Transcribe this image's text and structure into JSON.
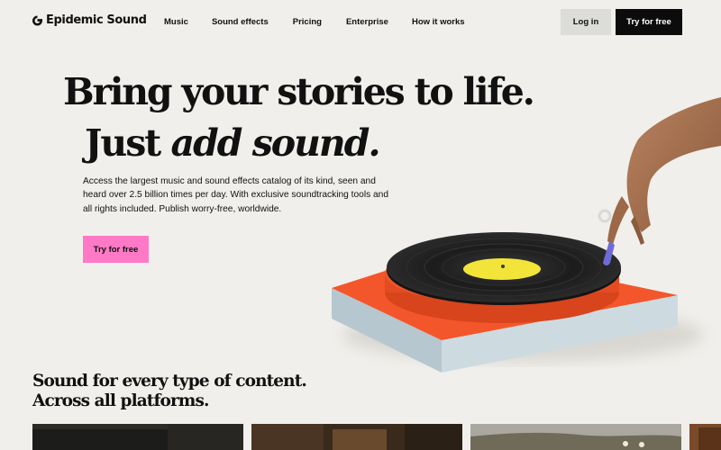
{
  "header": {
    "logo_text": "Epidemic Sound",
    "nav": [
      "Music",
      "Sound effects",
      "Pricing",
      "Enterprise",
      "How it works"
    ],
    "login_label": "Log in",
    "try_label": "Try for free"
  },
  "hero": {
    "headline_line1": "Bring your stories to life.",
    "headline_line2_plain": "Just ",
    "headline_line2_italic": "add sound.",
    "lead": "Access the largest music and sound effects catalog of its kind, seen and heard over 2.5 billion times per day. With exclusive soundtracking tools and all rights included. Publish worry-free, worldwide.",
    "cta_label": "Try for free"
  },
  "content_section": {
    "title_line1": "Sound for every type of content.",
    "title_line2": "Across all platforms."
  },
  "colors": {
    "background": "#f0efeb",
    "primary_button": "#0c0c0c",
    "secondary_button": "#dcdcd9",
    "cta_pink": "#ff79c6",
    "turntable_orange": "#f4562b",
    "record_label_yellow": "#f3e43a"
  },
  "icons": {
    "logo": "epidemic-sound-logo-icon"
  }
}
